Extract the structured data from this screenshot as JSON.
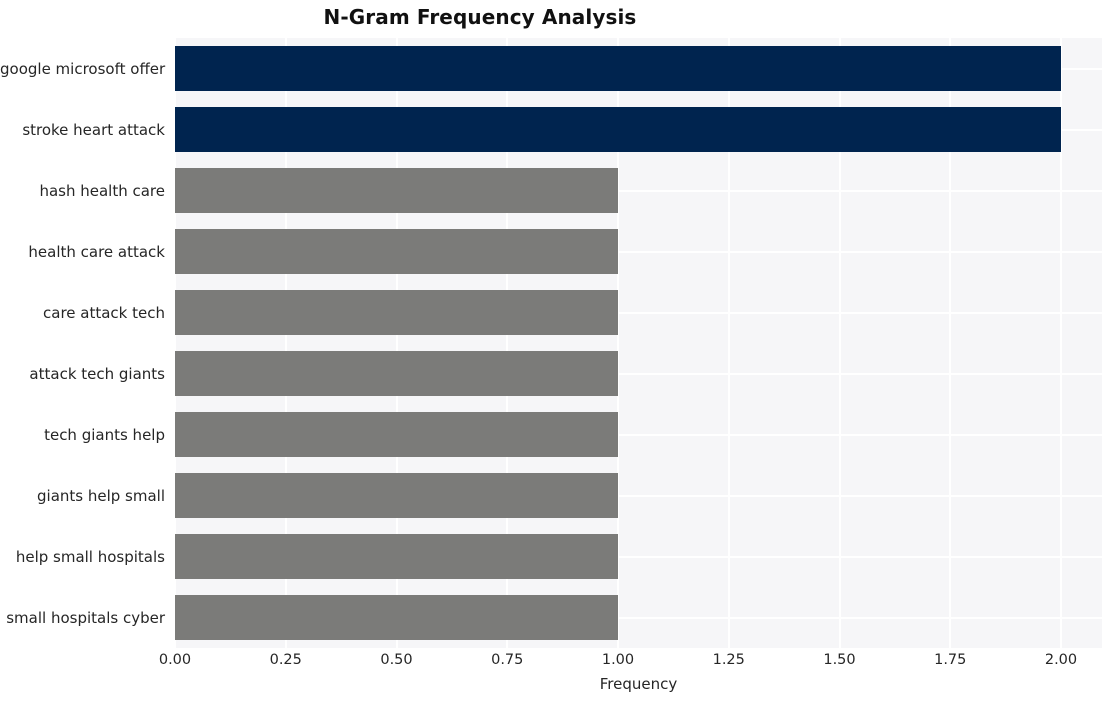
{
  "chart_data": {
    "type": "bar",
    "orientation": "horizontal",
    "title": "N-Gram Frequency Analysis",
    "xlabel": "Frequency",
    "ylabel": "",
    "categories": [
      "google microsoft offer",
      "stroke heart attack",
      "hash health care",
      "health care attack",
      "care attack tech",
      "attack tech giants",
      "tech giants help",
      "giants help small",
      "help small hospitals",
      "small hospitals cyber"
    ],
    "values": [
      2,
      2,
      1,
      1,
      1,
      1,
      1,
      1,
      1,
      1
    ],
    "bar_colors": [
      "#00244f",
      "#00244f",
      "#7b7b79",
      "#7b7b79",
      "#7b7b79",
      "#7b7b79",
      "#7b7b79",
      "#7b7b79",
      "#7b7b79",
      "#7b7b79"
    ],
    "xlim": [
      0,
      2.0
    ],
    "xticks": [
      0,
      0.25,
      0.5,
      0.75,
      1.0,
      1.25,
      1.5,
      1.75,
      2.0
    ],
    "xtick_labels": [
      "0.00",
      "0.25",
      "0.50",
      "0.75",
      "1.00",
      "1.25",
      "1.50",
      "1.75",
      "2.00"
    ],
    "grid": true,
    "legend": null,
    "style": {
      "plot_background": "#f6f6f8",
      "gridline_color": "#ffffff",
      "figure_background": "#ffffff",
      "text_color": "#262626",
      "title_color": "#111111",
      "highlight_color": "#00244f",
      "default_bar_color": "#7b7b79"
    }
  }
}
